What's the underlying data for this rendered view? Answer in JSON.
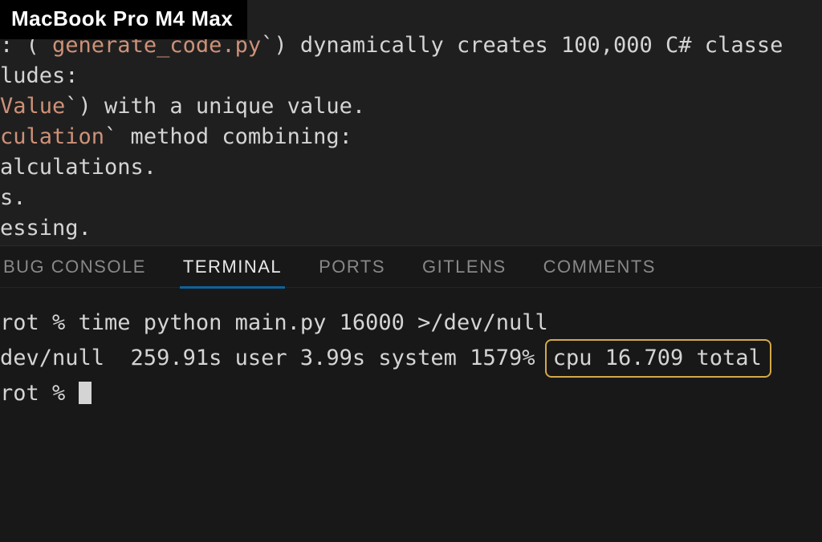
{
  "overlay": {
    "badge": "MacBook Pro M4 Max"
  },
  "editor": {
    "lines": {
      "l1_pre": ": (`",
      "l1_code": "generate_code.py",
      "l1_post": "`) dynamically creates 100,000 C# classe",
      "l2": "ludes:",
      "l3_code": "Value",
      "l3_post": "`) with a unique value.",
      "l4_code": "culation",
      "l4_post": "` method combining:",
      "l5": "alculations.",
      "l6": "s.",
      "l7": "essing."
    }
  },
  "tabs": {
    "debug_console": "BUG CONSOLE",
    "terminal": "TERMINAL",
    "ports": "PORTS",
    "gitlens": "GITLENS",
    "comments": "COMMENTS"
  },
  "terminal": {
    "line1": "rot % time python main.py 16000 >/dev/null",
    "line2_pre": "dev/null  259.91s user 3.99s system 1579% ",
    "line2_highlight": "cpu 16.709 total",
    "line3_pre": "rot % "
  },
  "colors": {
    "background": "#1a1a1a",
    "editor_bg": "#1f1f1f",
    "text": "#d4d4d4",
    "code_string": "#ce9178",
    "tab_active_underline": "#0e639c",
    "highlight_border": "#d4a94a"
  }
}
